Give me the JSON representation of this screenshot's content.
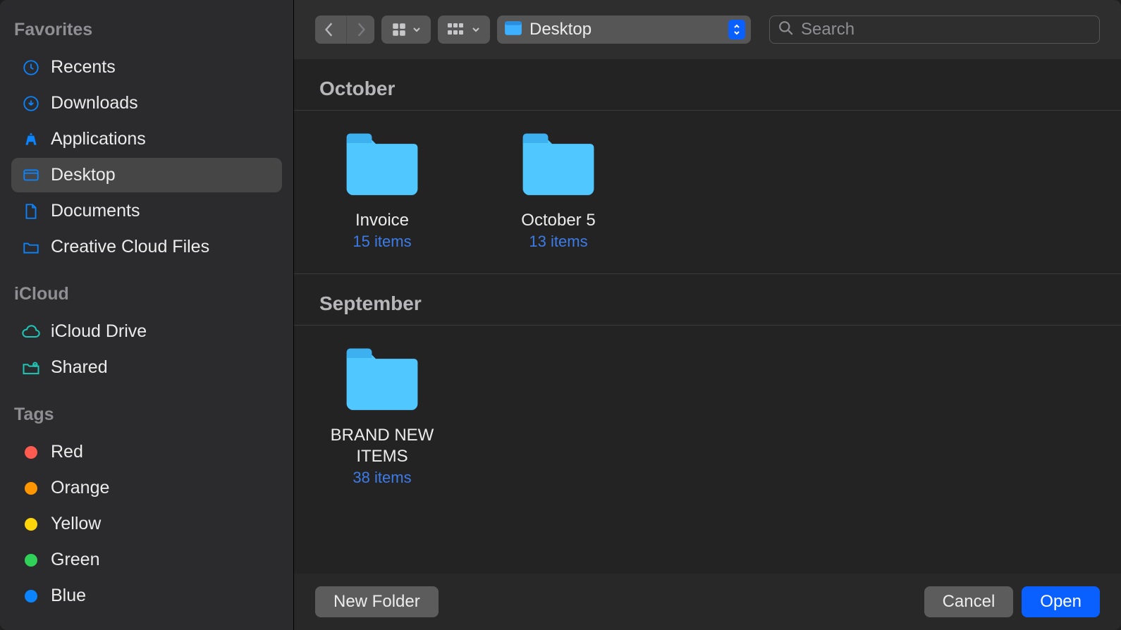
{
  "sidebar": {
    "sections": [
      {
        "heading": "Favorites",
        "items": [
          {
            "id": "recents",
            "label": "Recents",
            "icon": "clock",
            "selected": false
          },
          {
            "id": "downloads",
            "label": "Downloads",
            "icon": "download",
            "selected": false
          },
          {
            "id": "applications",
            "label": "Applications",
            "icon": "apps",
            "selected": false
          },
          {
            "id": "desktop",
            "label": "Desktop",
            "icon": "desktop",
            "selected": true
          },
          {
            "id": "documents",
            "label": "Documents",
            "icon": "document",
            "selected": false
          },
          {
            "id": "creative-cloud",
            "label": "Creative Cloud Files",
            "icon": "folder",
            "selected": false
          }
        ]
      },
      {
        "heading": "iCloud",
        "items": [
          {
            "id": "icloud-drive",
            "label": "iCloud Drive",
            "icon": "cloud",
            "selected": false
          },
          {
            "id": "shared",
            "label": "Shared",
            "icon": "shared-folder",
            "selected": false
          }
        ]
      },
      {
        "heading": "Tags",
        "items": [
          {
            "id": "tag-red",
            "label": "Red",
            "icon": "tag",
            "color": "#ff5b50",
            "selected": false
          },
          {
            "id": "tag-orange",
            "label": "Orange",
            "icon": "tag",
            "color": "#ff9500",
            "selected": false
          },
          {
            "id": "tag-yellow",
            "label": "Yellow",
            "icon": "tag",
            "color": "#ffd60a",
            "selected": false
          },
          {
            "id": "tag-green",
            "label": "Green",
            "icon": "tag",
            "color": "#30d158",
            "selected": false
          },
          {
            "id": "tag-blue",
            "label": "Blue",
            "icon": "tag",
            "color": "#0a84ff",
            "selected": false
          }
        ]
      }
    ]
  },
  "toolbar": {
    "location": "Desktop",
    "search_placeholder": "Search"
  },
  "content": {
    "sections": [
      {
        "title": "October",
        "folders": [
          {
            "name": "Invoice",
            "subtitle": "15 items"
          },
          {
            "name": "October 5",
            "subtitle": "13 items"
          }
        ]
      },
      {
        "title": "September",
        "folders": [
          {
            "name": "BRAND NEW ITEMS",
            "subtitle": "38 items"
          }
        ]
      }
    ]
  },
  "footer": {
    "new_folder": "New Folder",
    "cancel": "Cancel",
    "open": "Open"
  }
}
